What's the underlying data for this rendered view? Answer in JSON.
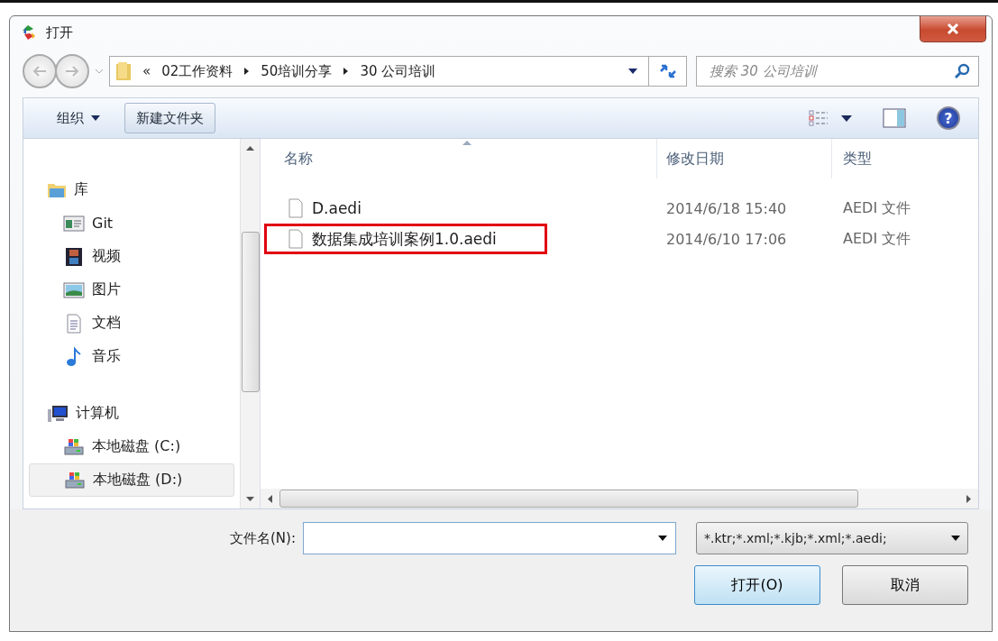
{
  "window": {
    "title": "打开"
  },
  "breadcrumb": {
    "overflow": "«",
    "segments": [
      "02工作资料",
      "50培训分享",
      "30 公司培训"
    ]
  },
  "search": {
    "placeholder": "搜索 30 公司培训"
  },
  "toolbar": {
    "organize": "组织",
    "new_folder": "新建文件夹",
    "help": "?"
  },
  "sidebar": {
    "groups": [
      {
        "label": "库",
        "children": [
          {
            "label": "Git",
            "selected": false
          },
          {
            "label": "视频",
            "selected": false
          },
          {
            "label": "图片",
            "selected": false
          },
          {
            "label": "文档",
            "selected": false
          },
          {
            "label": "音乐",
            "selected": false
          }
        ]
      },
      {
        "label": "计算机",
        "children": [
          {
            "label": "本地磁盘 (C:)",
            "selected": false
          },
          {
            "label": "本地磁盘 (D:)",
            "selected": true
          }
        ]
      }
    ]
  },
  "table": {
    "columns": [
      "名称",
      "修改日期",
      "类型"
    ],
    "rows": [
      {
        "name": "D.aedi",
        "date": "2014/6/18 15:40",
        "type": "AEDI 文件",
        "highlighted": false
      },
      {
        "name": "数据集成培训案例1.0.aedi",
        "date": "2014/6/10 17:06",
        "type": "AEDI 文件",
        "highlighted": true
      }
    ]
  },
  "filename": {
    "label": "文件名(N):"
  },
  "filter": {
    "value": "*.ktr;*.xml;*.kjb;*.xml;*.aedi;"
  },
  "buttons": [
    "打开(O)",
    "取消"
  ]
}
